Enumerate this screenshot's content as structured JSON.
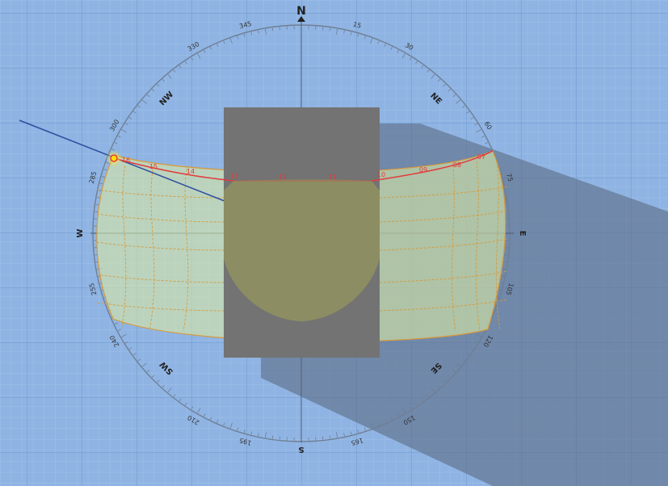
{
  "compass": {
    "cardinals": {
      "north": "N",
      "south": "S",
      "east": "E",
      "west": "W"
    },
    "intercardinals": {
      "northeast": "NE",
      "northwest": "NW",
      "southeast": "SE",
      "southwest": "SW"
    },
    "degree_labels": [
      {
        "deg": 15,
        "text": "15"
      },
      {
        "deg": 30,
        "text": "30"
      },
      {
        "deg": 60,
        "text": "60"
      },
      {
        "deg": 75,
        "text": "75"
      },
      {
        "deg": 105,
        "text": "105"
      },
      {
        "deg": 120,
        "text": "120"
      },
      {
        "deg": 150,
        "text": "150"
      },
      {
        "deg": 165,
        "text": "165"
      },
      {
        "deg": 195,
        "text": "195"
      },
      {
        "deg": 210,
        "text": "210"
      },
      {
        "deg": 240,
        "text": "240"
      },
      {
        "deg": 255,
        "text": "255"
      },
      {
        "deg": 285,
        "text": "285"
      },
      {
        "deg": 300,
        "text": "300"
      },
      {
        "deg": 330,
        "text": "330"
      },
      {
        "deg": 345,
        "text": "345"
      }
    ]
  },
  "sun_path": {
    "hour_labels": [
      "16",
      "15",
      "14",
      "13",
      "12",
      "11",
      "10",
      "09",
      "08",
      "07"
    ],
    "current_hour": "16"
  },
  "colors": {
    "background": "#8fb4e3",
    "grid_minor": "#a6c4ea",
    "grid_major": "#6e97cf",
    "compass_ring": "#6f7f95",
    "sun_path_line": "#e23b3b",
    "sun_band_fill": "#d7e6a6",
    "sun_band_stroke": "#d79a3a",
    "building": "#737373",
    "shadow": "#5d6e86",
    "sun_ray": "#2d4fa0",
    "sun_marker": "#ffe200"
  }
}
